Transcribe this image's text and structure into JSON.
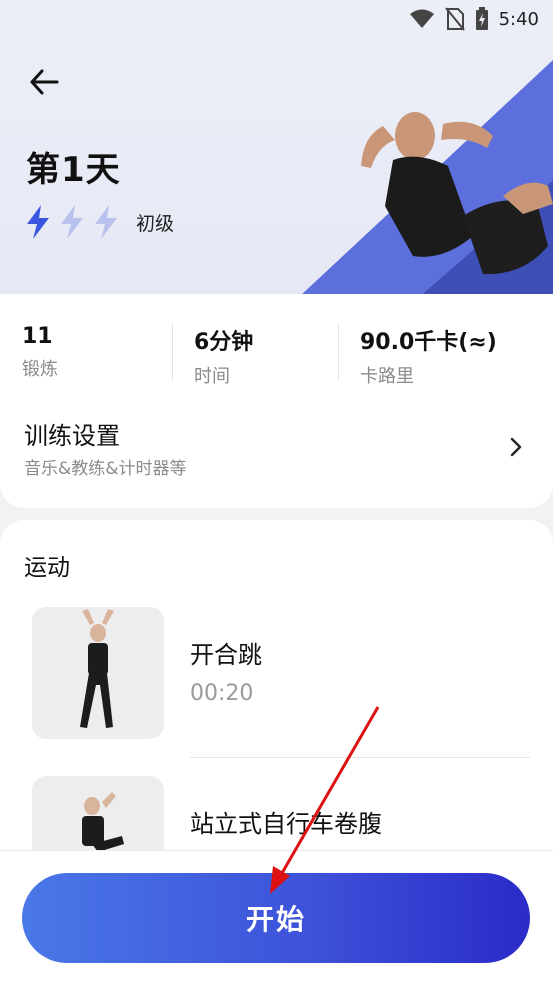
{
  "status_bar": {
    "time": "5:40",
    "icons": [
      "wifi-icon",
      "no-sim-icon",
      "battery-charging-icon"
    ]
  },
  "header": {
    "back_icon": "arrow-left-icon",
    "title": "第1天",
    "level": {
      "label": "初级",
      "filled": 1,
      "total": 3
    }
  },
  "stats": [
    {
      "value": "11",
      "label": "锻炼"
    },
    {
      "value": "6分钟",
      "label": "时间"
    },
    {
      "value": "90.0千卡(≈)",
      "label": "卡路里"
    }
  ],
  "settings": {
    "title": "训练设置",
    "subtitle": "音乐&教练&计时器等",
    "icon": "chevron-right-icon"
  },
  "exercises": {
    "heading": "运动",
    "items": [
      {
        "name": "开合跳",
        "duration": "00:20"
      },
      {
        "name": "站立式自行车卷腹",
        "duration": ""
      }
    ]
  },
  "start_button": {
    "label": "开始"
  },
  "colors": {
    "accent": "#3c4fd8",
    "bolt_active": "#3a55e0",
    "bolt_inactive": "#b9c2ee"
  }
}
